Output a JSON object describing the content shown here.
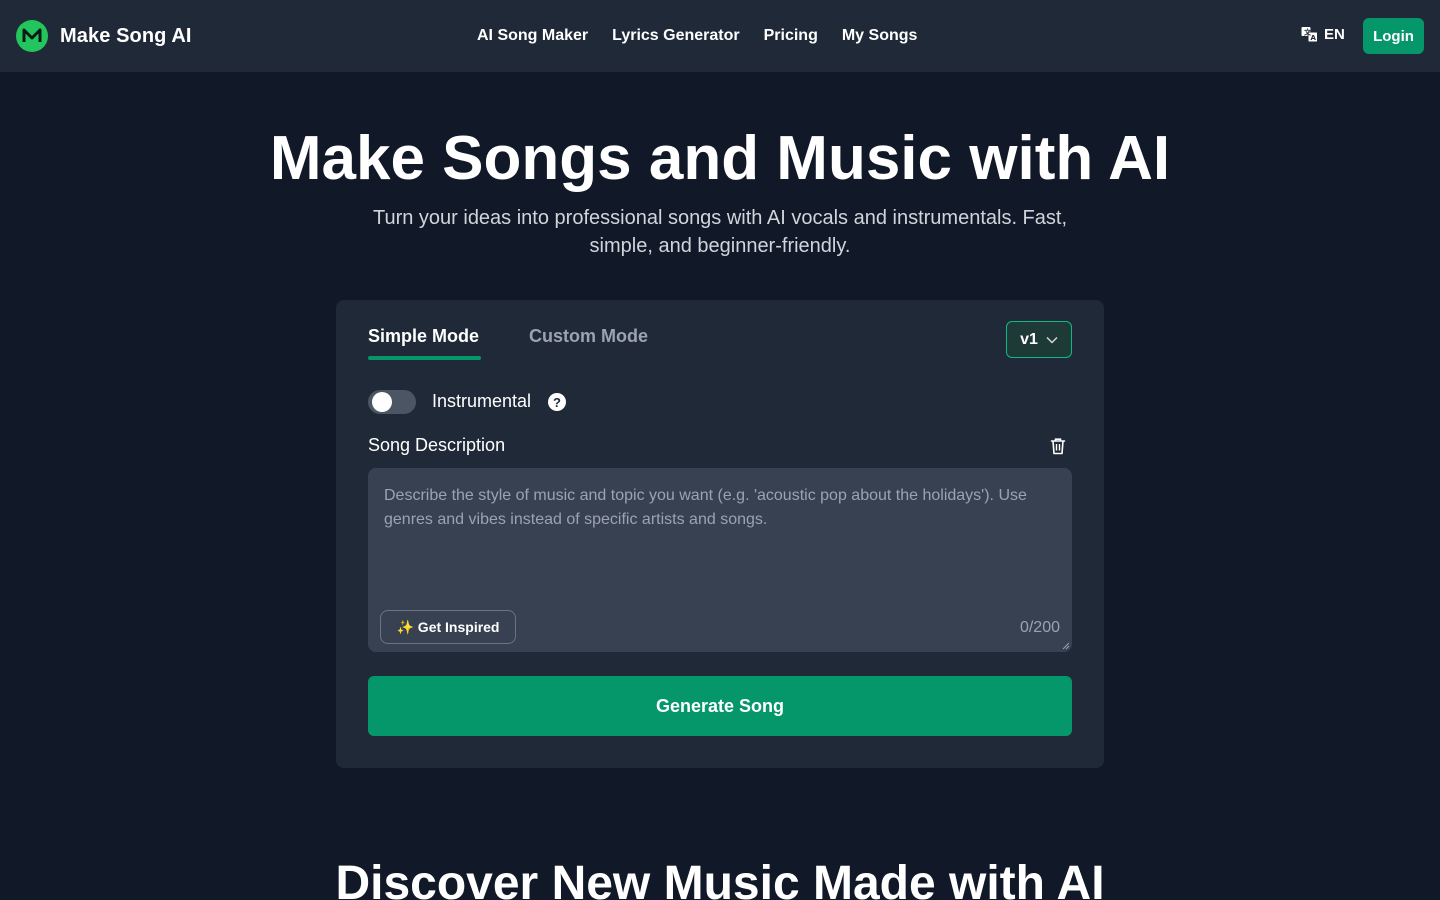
{
  "header": {
    "brand_name": "Make Song AI",
    "logo_letter": "M",
    "nav": [
      "AI Song Maker",
      "Lyrics Generator",
      "Pricing",
      "My Songs"
    ],
    "language": "EN",
    "login_label": "Login"
  },
  "hero": {
    "title": "Make Songs and Music with AI",
    "subtitle": "Turn your ideas into professional songs with AI vocals and instrumentals. Fast, simple, and beginner-friendly."
  },
  "generator": {
    "tabs": [
      "Simple Mode",
      "Custom Mode"
    ],
    "active_tab": "Simple Mode",
    "version": "v1",
    "instrumental_label": "Instrumental",
    "instrumental_on": false,
    "help_glyph": "?",
    "description_label": "Song Description",
    "description_placeholder": "Describe the style of music and topic you want (e.g. 'acoustic pop about the holidays'). Use genres and vibes instead of specific artists and songs.",
    "description_value": "",
    "inspire_label": "✨ Get Inspired",
    "char_count": "0/200",
    "generate_label": "Generate Song"
  },
  "discover": {
    "title": "Discover New Music Made with AI"
  },
  "colors": {
    "background": "#111827",
    "header_bg": "#1f2937",
    "card_bg": "#1f2937",
    "accent": "#059669",
    "input_bg": "#374151"
  }
}
